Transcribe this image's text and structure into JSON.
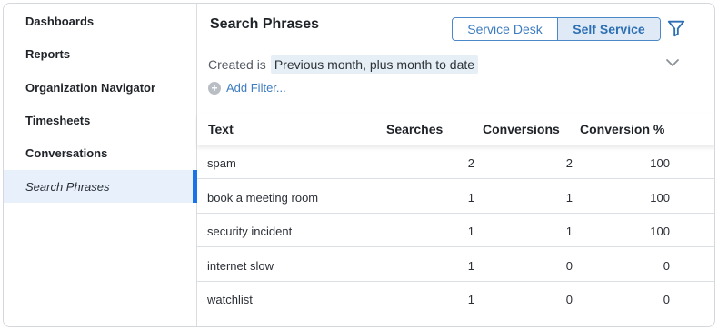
{
  "sidebar": {
    "items": [
      {
        "label": "Dashboards"
      },
      {
        "label": "Reports"
      },
      {
        "label": "Organization Navigator"
      },
      {
        "label": "Timesheets"
      },
      {
        "label": "Conversations"
      },
      {
        "label": "Search Phrases"
      }
    ],
    "active_index": 5
  },
  "header": {
    "title": "Search Phrases",
    "toggle": {
      "option_a": "Service Desk",
      "option_b": "Self Service",
      "selected": "Self Service"
    },
    "filter_icon": "filter-icon"
  },
  "criteria": {
    "field": "Created is",
    "value": "Previous month, plus month to date",
    "add_filter": "Add Filter..."
  },
  "table": {
    "columns": [
      "Text",
      "Searches",
      "Conversions",
      "Conversion %"
    ],
    "rows": [
      {
        "text": "spam",
        "searches": "2",
        "conversions": "2",
        "pct": "100"
      },
      {
        "text": "book a meeting room",
        "searches": "1",
        "conversions": "1",
        "pct": "100"
      },
      {
        "text": "security incident",
        "searches": "1",
        "conversions": "1",
        "pct": "100"
      },
      {
        "text": "internet slow",
        "searches": "1",
        "conversions": "0",
        "pct": "0"
      },
      {
        "text": "watchlist",
        "searches": "1",
        "conversions": "0",
        "pct": "0"
      }
    ]
  },
  "colors": {
    "accent": "#1b73e8",
    "link": "#3d7cc0",
    "active_bg": "#e7f0fb"
  }
}
